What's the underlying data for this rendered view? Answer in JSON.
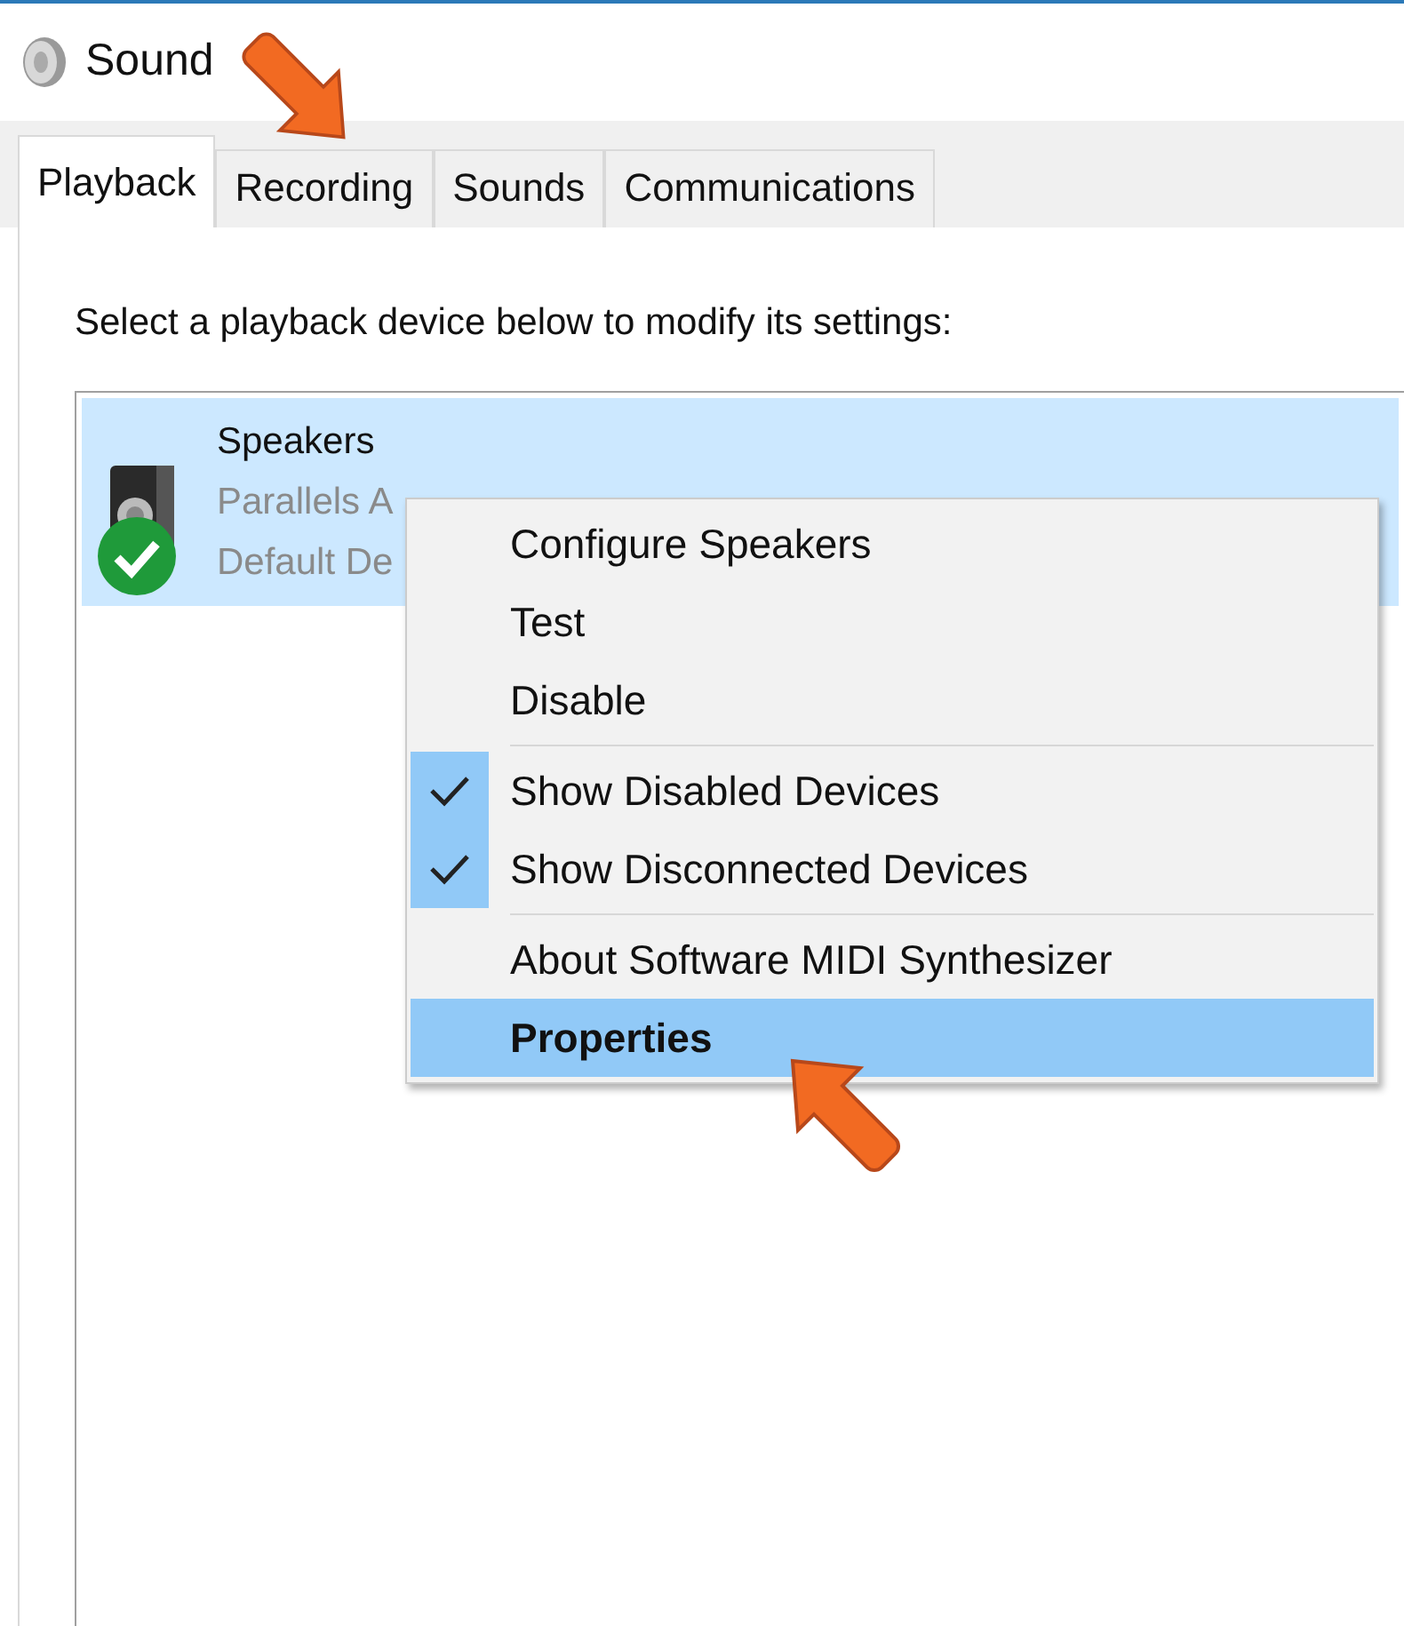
{
  "window": {
    "title": "Sound"
  },
  "tabs": [
    {
      "label": "Playback",
      "selected": true
    },
    {
      "label": "Recording",
      "selected": false
    },
    {
      "label": "Sounds",
      "selected": false
    },
    {
      "label": "Communications",
      "selected": false
    }
  ],
  "instruction": "Select a playback device below to modify its settings:",
  "devices": [
    {
      "name": "Speakers",
      "detail_1": "Parallels A",
      "detail_2": "Default De",
      "selected": true,
      "is_default": true
    }
  ],
  "context_menu": [
    {
      "kind": "item",
      "label": "Configure Speakers",
      "checked": false,
      "selected": false,
      "default": false
    },
    {
      "kind": "item",
      "label": "Test",
      "checked": false,
      "selected": false,
      "default": false
    },
    {
      "kind": "item",
      "label": "Disable",
      "checked": false,
      "selected": false,
      "default": false
    },
    {
      "kind": "separator"
    },
    {
      "kind": "item",
      "label": "Show Disabled Devices",
      "checked": true,
      "selected": false,
      "default": false
    },
    {
      "kind": "item",
      "label": "Show Disconnected Devices",
      "checked": true,
      "selected": false,
      "default": false
    },
    {
      "kind": "separator"
    },
    {
      "kind": "item",
      "label": "About Software MIDI Synthesizer",
      "checked": false,
      "selected": false,
      "default": false
    },
    {
      "kind": "item",
      "label": "Properties",
      "checked": false,
      "selected": true,
      "default": true
    }
  ]
}
